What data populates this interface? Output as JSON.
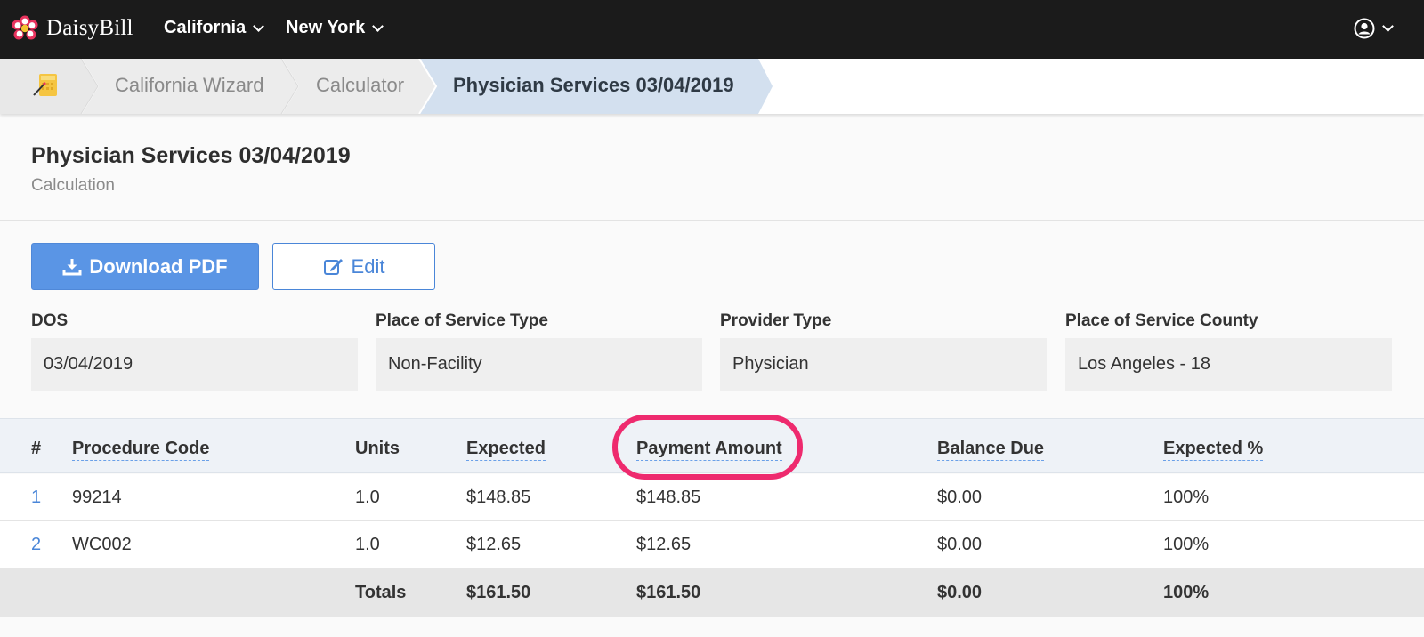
{
  "app": {
    "brand": "DaisyBill",
    "nav": [
      {
        "label": "California"
      },
      {
        "label": "New York"
      }
    ]
  },
  "breadcrumb": {
    "items": [
      {
        "label": "California Wizard"
      },
      {
        "label": "Calculator"
      },
      {
        "label": "Physician Services 03/04/2019"
      }
    ]
  },
  "header": {
    "title": "Physician Services 03/04/2019",
    "subtitle": "Calculation"
  },
  "actions": {
    "download_label": "Download PDF",
    "edit_label": "Edit"
  },
  "fields": [
    {
      "label": "DOS",
      "value": "03/04/2019"
    },
    {
      "label": "Place of Service Type",
      "value": "Non-Facility"
    },
    {
      "label": "Provider Type",
      "value": "Physician"
    },
    {
      "label": "Place of Service County",
      "value": "Los Angeles - 18"
    }
  ],
  "table": {
    "columns": [
      "#",
      "Procedure Code",
      "Units",
      "Expected",
      "Payment Amount",
      "Balance Due",
      "Expected %"
    ],
    "rows": [
      {
        "num": "1",
        "code": "99214",
        "units": "1.0",
        "expected": "$148.85",
        "payment": "$148.85",
        "balance": "$0.00",
        "pct": "100%"
      },
      {
        "num": "2",
        "code": "WC002",
        "units": "1.0",
        "expected": "$12.65",
        "payment": "$12.65",
        "balance": "$0.00",
        "pct": "100%"
      }
    ],
    "totals": {
      "label": "Totals",
      "expected": "$161.50",
      "payment": "$161.50",
      "balance": "$0.00",
      "pct": "100%"
    }
  },
  "colors": {
    "topbar": "#1b1b1b",
    "primary": "#5a95e5",
    "highlight": "#ee2a6e",
    "active_crumb": "#d3e0ef"
  }
}
